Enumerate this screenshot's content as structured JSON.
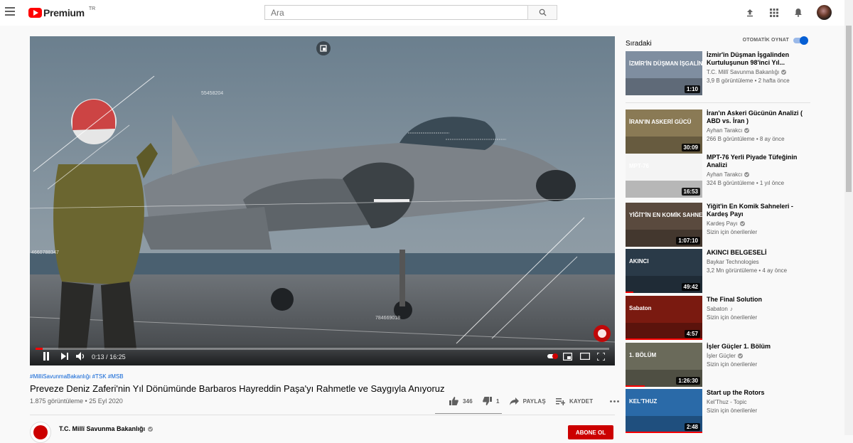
{
  "header": {
    "logo_text": "Premium",
    "logo_country": "TR",
    "search_placeholder": "Ara"
  },
  "player": {
    "current_time": "0:13",
    "separator": "/",
    "duration": "16:25",
    "progress_fraction": 0.013,
    "overlay_numbers": [
      "55458204",
      "4660788347",
      "784669018"
    ]
  },
  "video": {
    "hashtags": "#MilliSavunmaBakanlığı #TSK #MSB",
    "title": "Preveze Deniz Zaferi'nin Yıl Dönümünde Barbaros Hayreddin Paşa'yı Rahmetle ve Saygıyla Anıyoruz",
    "views_date": "1.875 görüntüleme • 25 Eyl 2020",
    "likes": "346",
    "dislikes": "1",
    "share_label": "PAYLAŞ",
    "save_label": "KAYDET",
    "channel_name": "T.C. Millî Savunma Bakanlığı",
    "subscribe_label": "ABONE OL"
  },
  "sidebar": {
    "title": "Sıradaki",
    "autoplay_label": "OTOMATİK OYNAT",
    "autoplay_on": true,
    "items": [
      {
        "title": "İzmir'in Düşman İşgalinden Kurtuluşunun 98'inci Yıl...",
        "channel": "T.C. Millî Savunma Bakanlığı",
        "verified": true,
        "meta": "3,9 B görüntüleme • 2 hafta önce",
        "duration": "1:10",
        "thumb_text": "İZMİR'İN DÜŞMAN İŞGALİNDEN KURTULUŞU",
        "thumb_bg": "#7f8ea0"
      },
      {
        "title": "İran'ın Askeri Gücünün Analizi ( ABD vs. İran )",
        "channel": "Ayhan Tarakcı",
        "verified": true,
        "meta": "266 B görüntüleme • 8 ay önce",
        "duration": "30:09",
        "thumb_text": "İRAN'IN ASKERİ GÜCÜ",
        "thumb_bg": "#8a7a55"
      },
      {
        "title": "MPT-76 Yerli Piyade Tüfeğinin Analizi",
        "channel": "Ayhan Tarakcı",
        "verified": true,
        "meta": "324 B görüntüleme • 1 yıl önce",
        "duration": "16:53",
        "thumb_text": "MPT-76",
        "thumb_bg": "#f4f4f4"
      },
      {
        "title": "Yiğit'in En Komik Sahneleri - Kardeş Payı",
        "channel": "Kardeş Payı",
        "verified": true,
        "meta": "Sizin için önerilenler",
        "duration": "1:07:10",
        "thumb_text": "YİĞİT'İN EN KOMİK SAHNELERİ",
        "thumb_bg": "#5a4a3e"
      },
      {
        "title": "AKINCI BELGESELİ",
        "channel": "Baykar Technologies",
        "verified": false,
        "meta": "3,2 Mn görüntüleme • 4 ay önce",
        "duration": "49:42",
        "thumb_text": "AKINCI",
        "thumb_bg": "#2a3a48",
        "watched": 0.1
      },
      {
        "title": "The Final Solution",
        "channel": "Sabaton",
        "verified": false,
        "music": true,
        "meta": "Sizin için önerilenler",
        "duration": "4:57",
        "thumb_text": "Sabaton",
        "thumb_bg": "#7a1a10",
        "watched": 1
      },
      {
        "title": "İşler Güçler 1. Bölüm",
        "channel": "İşler Güçler",
        "verified": true,
        "meta": "Sizin için önerilenler",
        "duration": "1:26:30",
        "thumb_text": "1. BÖLÜM",
        "thumb_bg": "#6a6a5a",
        "watched": 0.25
      },
      {
        "title": "Start up the Rotors",
        "channel": "Kel'Thuz - Topic",
        "verified": false,
        "meta": "Sizin için önerilenler",
        "duration": "2:48",
        "thumb_text": "KEL'THUZ",
        "thumb_bg": "#2a6aa8",
        "watched": 1
      }
    ]
  },
  "colors": {
    "brand_red": "#ff0000",
    "link_blue": "#065fd4",
    "subscribe_red": "#cc0000"
  }
}
